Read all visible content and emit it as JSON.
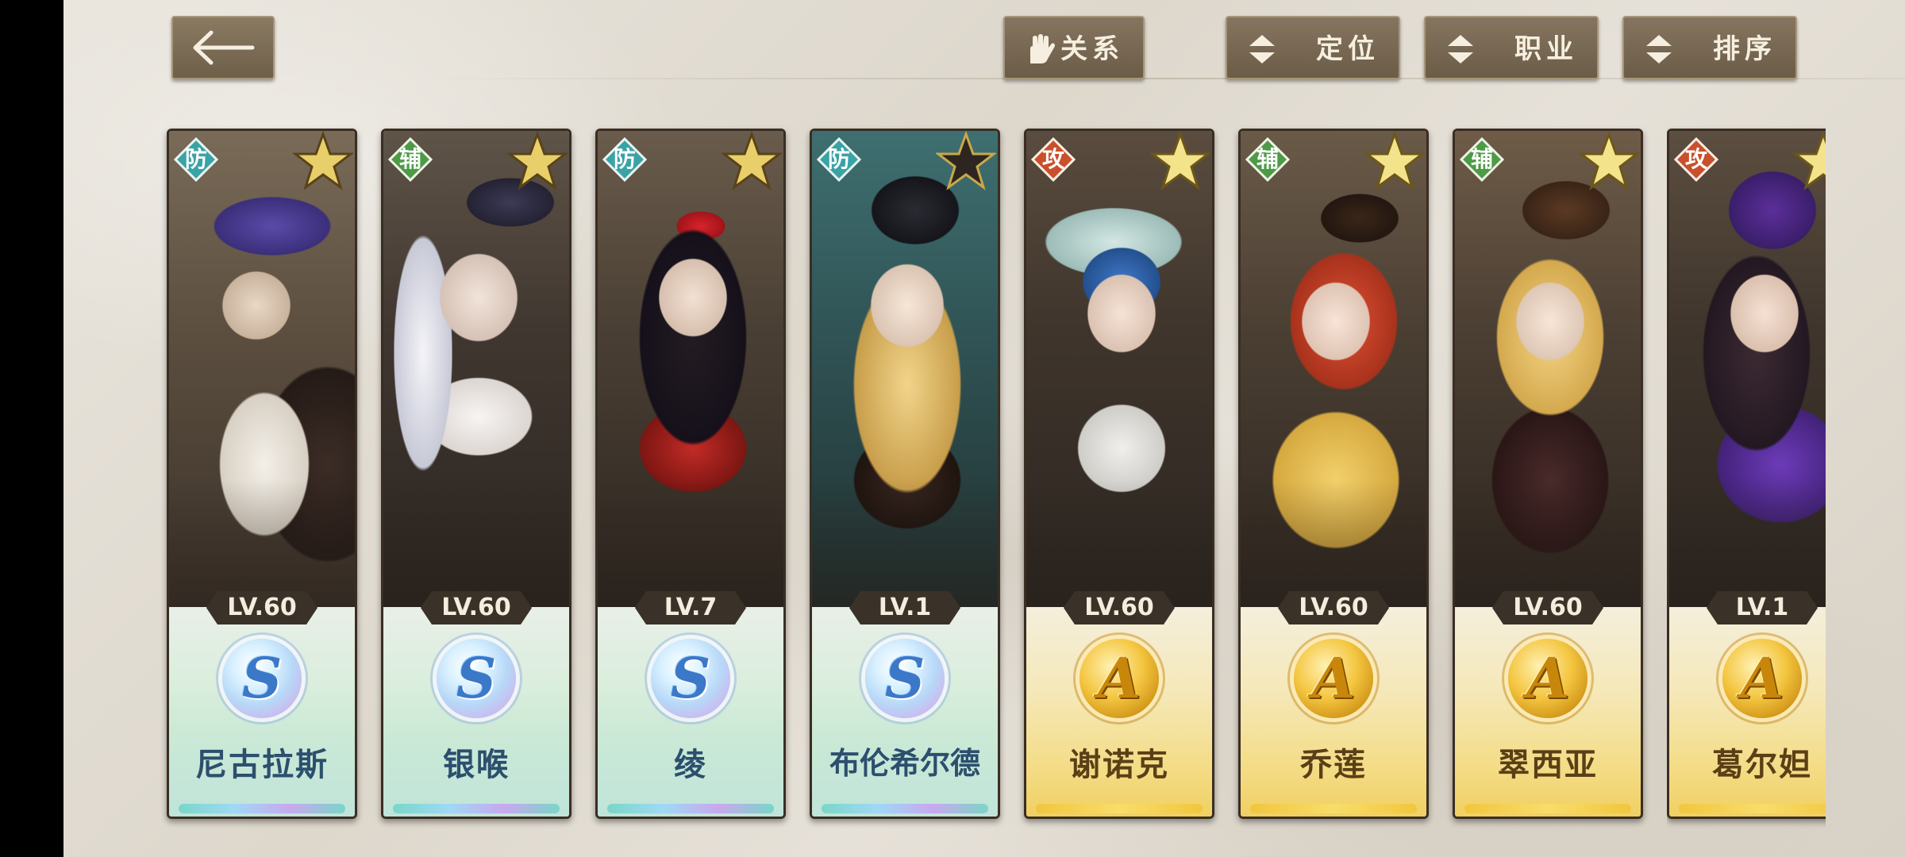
{
  "toolbar": {
    "back_icon": "back-arrow-icon",
    "buttons": [
      {
        "label": "关系",
        "icon": "glove-icon"
      },
      {
        "label": "定位",
        "icon": "sort-updown-icon"
      },
      {
        "label": "职业",
        "icon": "sort-updown-icon"
      },
      {
        "label": "排序",
        "icon": "sort-updown-icon"
      }
    ]
  },
  "colors": {
    "defense": "#3aa3a6",
    "support": "#4e9a47",
    "attack": "#c8502c",
    "s_rank": "#3c78c8",
    "a_rank": "#c8860a"
  },
  "characters": [
    {
      "role": "防",
      "role_type": "defense",
      "level": "LV.60",
      "rarity": "S",
      "name": "尼古拉斯"
    },
    {
      "role": "辅",
      "role_type": "support",
      "level": "LV.60",
      "rarity": "S",
      "name": "银喉"
    },
    {
      "role": "防",
      "role_type": "defense",
      "level": "LV.7",
      "rarity": "S",
      "name": "绫"
    },
    {
      "role": "防",
      "role_type": "defense",
      "level": "LV.1",
      "rarity": "S",
      "name": "布伦希尔德"
    },
    {
      "role": "攻",
      "role_type": "attack",
      "level": "LV.60",
      "rarity": "A",
      "name": "谢诺克"
    },
    {
      "role": "辅",
      "role_type": "support",
      "level": "LV.60",
      "rarity": "A",
      "name": "乔莲"
    },
    {
      "role": "辅",
      "role_type": "support",
      "level": "LV.60",
      "rarity": "A",
      "name": "翠西亚"
    },
    {
      "role": "攻",
      "role_type": "attack",
      "level": "LV.1",
      "rarity": "A",
      "name": "葛尔妲"
    }
  ]
}
